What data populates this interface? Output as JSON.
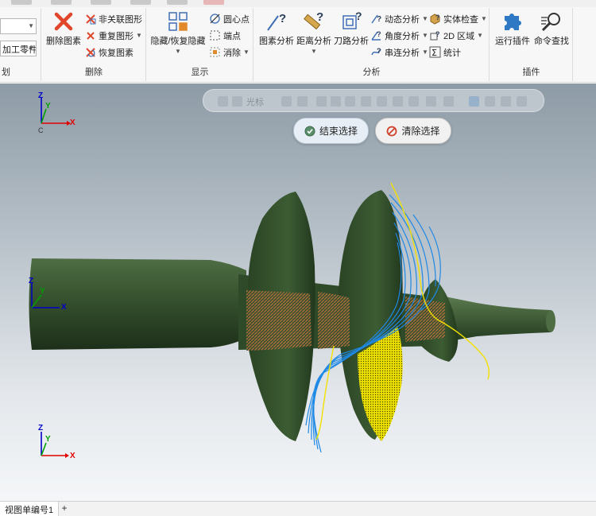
{
  "left_partial": {
    "combo1_value": "",
    "combo2_value": "加工零件",
    "group_label": "划"
  },
  "delete_group": {
    "label": "删除",
    "delete_button": "删除图素",
    "non_assoc": "非关联图形",
    "duplicate": "重复图形",
    "restore": "恢复图素"
  },
  "display_group": {
    "label": "显示",
    "hide_restore": "隐藏/恢复隐藏",
    "center_point": "圆心点",
    "endpoint": "端点",
    "eliminate": "消除"
  },
  "analysis_group": {
    "label": "分析",
    "entity_analysis": "图素分析",
    "distance_analysis": "距离分析",
    "toolpath_analysis": "刀路分析",
    "dynamic_analysis": "动态分析",
    "angle_analysis": "角度分析",
    "chain_analysis": "串连分析",
    "solid_check": "实体检查",
    "region_2d": "2D 区域",
    "statistics": "统计"
  },
  "plugin_group": {
    "label": "插件",
    "run_plugin": "运行插件",
    "command_finder": "命令查找"
  },
  "float_toolbar": {
    "label": "光标"
  },
  "selection": {
    "finish": "结束选择",
    "clear": "清除选择"
  },
  "triads": {
    "top": {
      "x": "X",
      "y": "Y",
      "z": "Z",
      "c": "C"
    },
    "middle": {
      "x": "X",
      "y": "Y",
      "z": "Z"
    },
    "bottom": {
      "x": "X",
      "y": "Y",
      "z": "Z"
    }
  },
  "bottom_tabs": {
    "view_tab": "视图单编号1",
    "add": "+"
  },
  "colors": {
    "model_green": "#33502c",
    "highlight_blue": "#1e88e5",
    "highlight_yellow": "#f2e000",
    "axis_x": "#e00000",
    "axis_y": "#00a000",
    "axis_z": "#0000c8"
  }
}
